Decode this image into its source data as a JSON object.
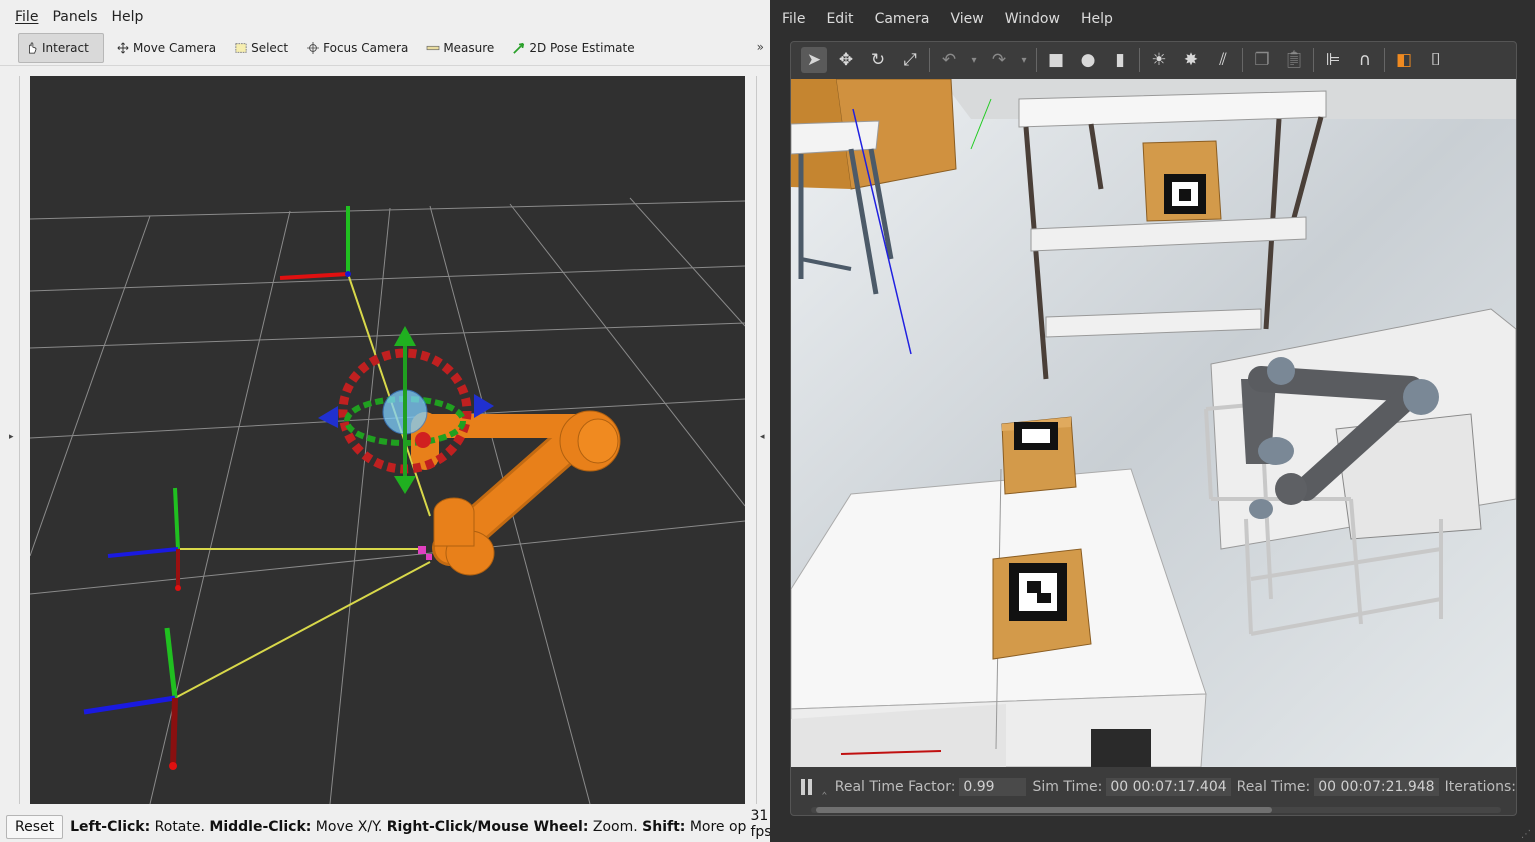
{
  "rviz": {
    "menu": [
      "File",
      "Panels",
      "Help"
    ],
    "tools": [
      {
        "label": "Interact",
        "icon": "hand-cursor-icon",
        "active": true
      },
      {
        "label": "Move Camera",
        "icon": "move-arrows-icon",
        "active": false
      },
      {
        "label": "Select",
        "icon": "selection-box-icon",
        "active": false
      },
      {
        "label": "Focus Camera",
        "icon": "crosshair-icon",
        "active": false
      },
      {
        "label": "Measure",
        "icon": "ruler-icon",
        "active": false
      },
      {
        "label": "2D Pose Estimate",
        "icon": "green-arrow-icon",
        "active": false
      }
    ],
    "more_tools": "»",
    "status": {
      "reset_label": "Reset",
      "left_click_key": "Left-Click:",
      "left_click_action": " Rotate. ",
      "middle_click_key": "Middle-Click:",
      "middle_click_action": " Move X/Y. ",
      "right_click_key": "Right-Click/Mouse Wheel:",
      "right_click_action": " Zoom. ",
      "shift_key": "Shift:",
      "shift_action": " More op",
      "fps": "31 fps"
    },
    "colors": {
      "robot": "#e8801a",
      "grid_bg": "#303030",
      "axis_x": "#e01010",
      "axis_y": "#10c010",
      "axis_z": "#1010e0",
      "link_line": "#d8d84a"
    }
  },
  "gazebo": {
    "menu": [
      "File",
      "Edit",
      "Camera",
      "View",
      "Window",
      "Help"
    ],
    "toolbar_icons": [
      "select-arrow-icon",
      "translate-icon",
      "rotate-icon",
      "scale-icon",
      "undo-icon",
      "undo-dropdown-icon",
      "redo-icon",
      "redo-dropdown-icon",
      "box-shape-icon",
      "sphere-shape-icon",
      "cylinder-shape-icon",
      "point-light-icon",
      "spot-light-icon",
      "directional-light-icon",
      "copy-icon",
      "paste-icon",
      "align-icon",
      "magnet-icon",
      "view-angle-icon",
      "camera-icon"
    ],
    "stats": {
      "real_time_factor_label": "Real Time Factor:",
      "real_time_factor": "0.99",
      "sim_time_label": "Sim Time:",
      "sim_time": "00 00:07:17.404",
      "real_time_label": "Real Time:",
      "real_time": "00 00:07:21.948",
      "iterations_label": "Iterations:"
    },
    "colors": {
      "box": "#d39a4a",
      "table": "#f2f2f2",
      "robot_body": "#5e6064",
      "robot_joint": "#7a8896"
    }
  }
}
